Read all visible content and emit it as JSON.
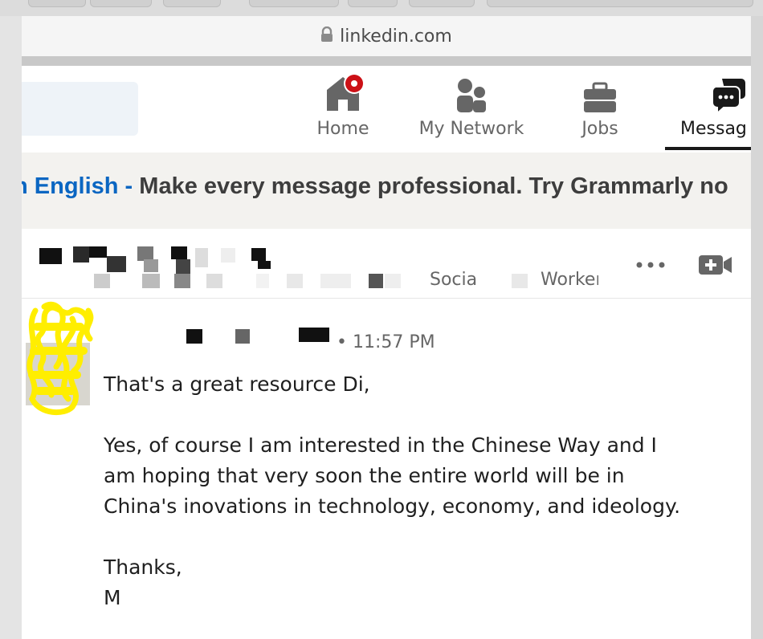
{
  "browser": {
    "url": "linkedin.com"
  },
  "nav": {
    "items": [
      {
        "label": "Home",
        "icon": "home-icon",
        "badge": true
      },
      {
        "label": "My Network",
        "icon": "people-icon"
      },
      {
        "label": "Jobs",
        "icon": "briefcase-icon"
      },
      {
        "label": "Messag",
        "icon": "messaging-icon",
        "active": true
      }
    ]
  },
  "banner": {
    "prefix": "n English",
    "dash": " - ",
    "text": "Make every message professional. Try Grammarly no"
  },
  "conversation": {
    "title_fragment_1": "Socia",
    "title_fragment_2": "Worker"
  },
  "message": {
    "time": "• 11:57 PM",
    "paragraphs": [
      "That's a great resource Di,",
      "Yes, of course I am interested in the Chinese Way and I am hoping that very soon the entire world will be in China's inovations in technology, economy, and ideology.",
      "Thanks,",
      "M"
    ]
  },
  "colors": {
    "linkedin_blue": "#0a66c2",
    "badge_red": "#cc1016",
    "scribble_yellow": "#ffee00"
  }
}
